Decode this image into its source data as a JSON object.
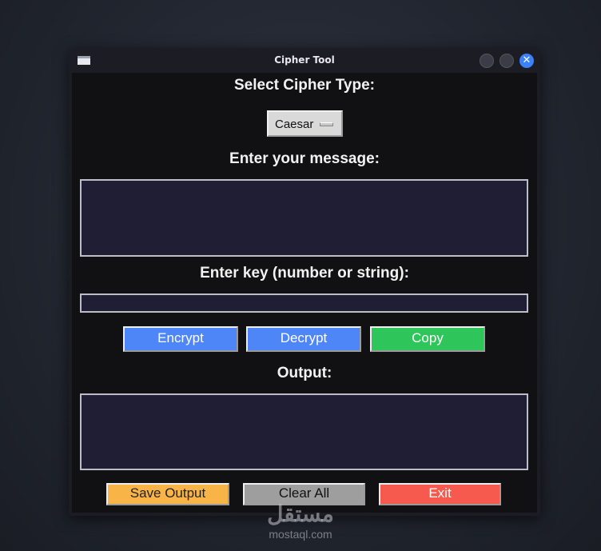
{
  "window": {
    "title": "Cipher Tool",
    "close_symbol": "✕"
  },
  "cipher": {
    "label": "Select Cipher Type:",
    "selected": "Caesar"
  },
  "message": {
    "label": "Enter your message:",
    "value": ""
  },
  "key": {
    "label": "Enter key (number or string):",
    "value": ""
  },
  "actions": {
    "encrypt": "Encrypt",
    "decrypt": "Decrypt",
    "copy": "Copy"
  },
  "output": {
    "label": "Output:",
    "value": ""
  },
  "footer": {
    "save": "Save Output",
    "clear": "Clear All",
    "exit": "Exit"
  },
  "colors": {
    "encrypt": "#4f86f7",
    "copy": "#2ec55a",
    "save": "#f9b448",
    "clear": "#9e9e9e",
    "exit": "#f65a4f"
  },
  "watermark": {
    "arabic": "مستقل",
    "latin": "mostaql.com"
  }
}
